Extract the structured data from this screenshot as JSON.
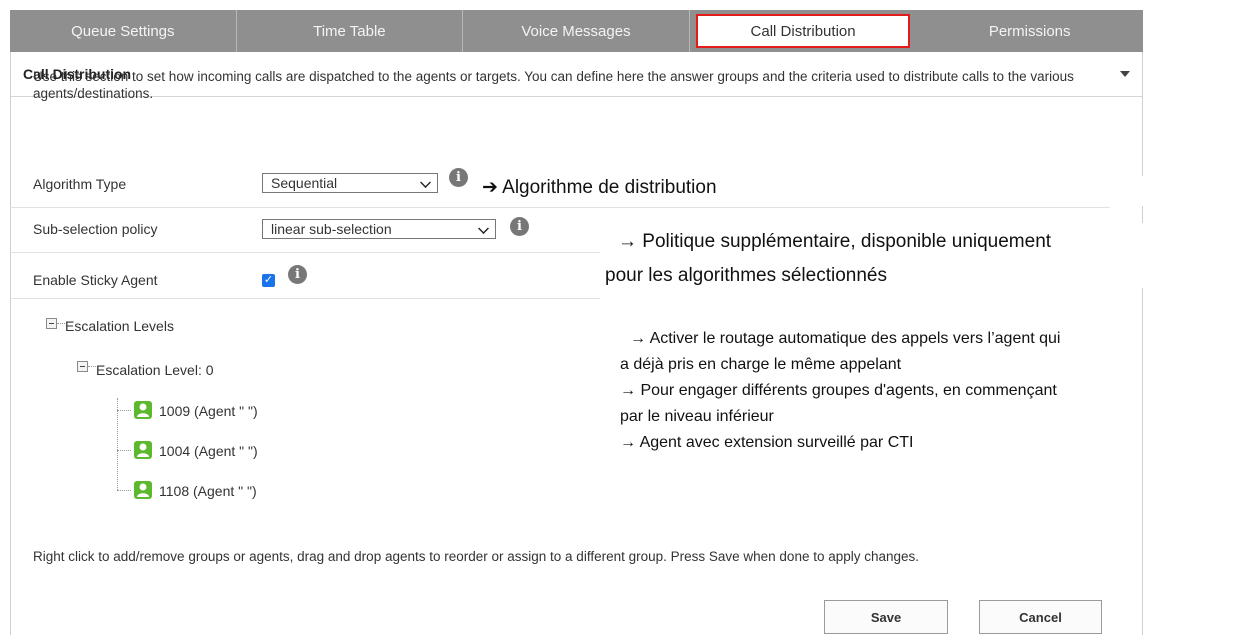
{
  "tabs": [
    {
      "label": "Queue Settings"
    },
    {
      "label": "Time Table"
    },
    {
      "label": "Voice Messages"
    },
    {
      "label": "Call Distribution"
    },
    {
      "label": "Permissions"
    }
  ],
  "panel": {
    "title": "Call Distribution",
    "intro": "Use this section to set how incoming calls are dispatched to the agents or targets. You can define here the answer groups and the criteria used to distribute calls to the various agents/destinations."
  },
  "form": {
    "algorithm_label": "Algorithm Type",
    "algorithm_value": "Sequential",
    "subselection_label": "Sub-selection policy",
    "subselection_value": "linear sub-selection",
    "sticky_label": "Enable Sticky Agent",
    "info_glyph": "i"
  },
  "tree": {
    "root": "Escalation Levels",
    "level": "Escalation Level: 0",
    "agents": [
      "1009 (Agent \" \")",
      "1004 (Agent \" \")",
      "1108 (Agent \" \")"
    ]
  },
  "footer": {
    "help": "Right click to add/remove groups or agents, drag and drop agents to reorder or assign to a different group. Press Save when done to apply changes.",
    "save": "Save",
    "cancel": "Cancel"
  },
  "annotations": {
    "a1": "➔ Algorithme de distribution",
    "a2_line1": "→  Politique supplémentaire, disponible uniquement",
    "a2_line2": "pour les algorithmes sélectionnés",
    "a3_line1": "→ Activer le routage automatique des appels vers l’agent qui",
    "a3_line2": "a déjà pris en charge le même appelant",
    "a4_line1": "→ Pour engager différents groupes d'agents, en commençant",
    "a4_line2": "par le niveau inférieur",
    "a5": "→ Agent avec extension surveillé par CTI"
  },
  "colors": {
    "tab_bar": "#8f8f8f",
    "active_border": "#e41b1b",
    "checkbox": "#1a73e8",
    "agent_icon": "#5cb82c"
  }
}
